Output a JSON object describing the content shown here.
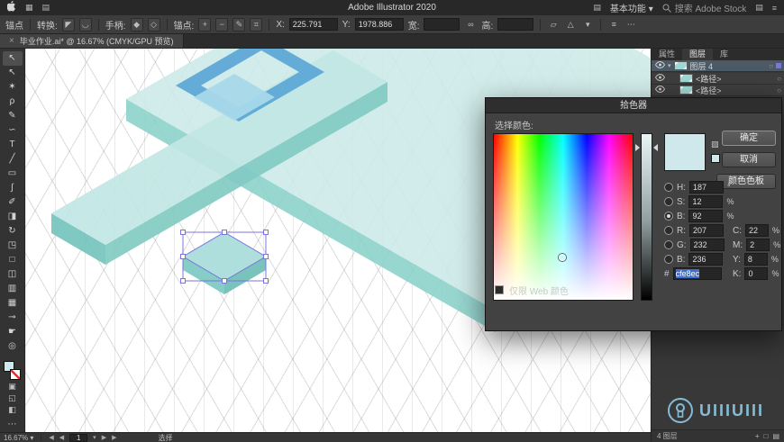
{
  "menubar": {
    "app_title": "Adobe Illustrator 2020",
    "workspace_label": "基本功能",
    "search_placeholder": "搜索 Adobe Stock"
  },
  "controlbar": {
    "anchor_label": "锚点",
    "convert_label": "转换:",
    "handles_label": "手柄:",
    "anchors_label": "锚点:",
    "x_label": "X:",
    "x_value": "225.791",
    "y_label": "Y:",
    "y_value": "1978.886",
    "width_label": "宽:",
    "width_value": "",
    "height_label": "高:",
    "height_value": ""
  },
  "tabbar": {
    "document_title": "毕业作业.ai* @ 16.67% (CMYK/GPU 预览)"
  },
  "toolbar": {
    "fill_color": "#cfe8ec",
    "tools": [
      {
        "name": "selection-tool",
        "glyph": "↖",
        "active": true
      },
      {
        "name": "direct-selection-tool",
        "glyph": "↖"
      },
      {
        "name": "magic-wand-tool",
        "glyph": "✶"
      },
      {
        "name": "lasso-tool",
        "glyph": "ρ"
      },
      {
        "name": "pen-tool",
        "glyph": "✎"
      },
      {
        "name": "curvature-tool",
        "glyph": "∽"
      },
      {
        "name": "type-tool",
        "glyph": "T"
      },
      {
        "name": "line-segment-tool",
        "glyph": "╱"
      },
      {
        "name": "rectangle-tool",
        "glyph": "▭"
      },
      {
        "name": "paintbrush-tool",
        "glyph": "∫"
      },
      {
        "name": "pencil-tool",
        "glyph": "✐"
      },
      {
        "name": "eraser-tool",
        "glyph": "◨"
      },
      {
        "name": "rotate-tool",
        "glyph": "↻"
      },
      {
        "name": "scale-tool",
        "glyph": "◳"
      },
      {
        "name": "free-transform-tool",
        "glyph": "□"
      },
      {
        "name": "shape-builder-tool",
        "glyph": "◫"
      },
      {
        "name": "gradient-tool",
        "glyph": "▥"
      },
      {
        "name": "mesh-tool",
        "glyph": "▦"
      },
      {
        "name": "eyedropper-tool",
        "glyph": "⊸"
      },
      {
        "name": "hand-tool",
        "glyph": "☛"
      },
      {
        "name": "zoom-tool",
        "glyph": "◎"
      }
    ]
  },
  "dialog": {
    "title": "拾色器",
    "select_label": "选择颜色:",
    "ok_label": "确定",
    "cancel_label": "取消",
    "swatches_label": "颜色色板",
    "preview_color": "#cfe8ec",
    "hsb": [
      {
        "label": "H:",
        "value": "187",
        "unit": "°"
      },
      {
        "label": "S:",
        "value": "12",
        "unit": "%"
      },
      {
        "label": "B:",
        "value": "92",
        "unit": "%"
      }
    ],
    "rgb": [
      {
        "label": "R:",
        "value": "207"
      },
      {
        "label": "G:",
        "value": "232"
      },
      {
        "label": "B:",
        "value": "236"
      }
    ],
    "cmyk": [
      {
        "label": "C:",
        "value": "22",
        "unit": "%"
      },
      {
        "label": "M:",
        "value": "2",
        "unit": "%"
      },
      {
        "label": "Y:",
        "value": "8",
        "unit": "%"
      },
      {
        "label": "K:",
        "value": "0",
        "unit": "%"
      }
    ],
    "hex_label": "#",
    "hex_value": "cfe8ec",
    "web_only_label": "仅限 Web 颜色"
  },
  "layers_panel": {
    "tabs": [
      {
        "label": "属性"
      },
      {
        "label": "图层"
      },
      {
        "label": "库"
      }
    ],
    "rows": [
      {
        "name": "图层 4"
      },
      {
        "name": "<路径>"
      },
      {
        "name": "<路径>"
      }
    ],
    "footer_count": "4 图层"
  },
  "statusbar": {
    "zoom": "16.67%",
    "artboard_value": "1",
    "status_text": "选择"
  },
  "watermark": {
    "text": "UIIIUIII"
  },
  "artwork": {
    "selection_color": "#7b74dd",
    "slab_fill": "#cdeae8",
    "slab_edge": "#8dd2cb",
    "plank_fill": "#c2e7e4",
    "plank_edge": "#82cbc3",
    "plank_end": "#76c4bd",
    "blue_frame": "#5ea9d6",
    "blue_diamond": "#a8d8ea",
    "object_top": "#aedfdc",
    "object_side_l": "#85cdc6",
    "object_side_r": "#79c3bc"
  },
  "icons": {
    "caret_down": "▾",
    "target_circle": "○",
    "close": "×",
    "ellipsis": "⋯",
    "menu": "≡",
    "grid_a": "▦",
    "grid_b": "▤",
    "convert_a": "◤",
    "convert_b": "◡",
    "handle_show": "◆",
    "handle_hide": "◇",
    "anchor_add": "+",
    "anchor_remove": "−",
    "pen": "✎",
    "crosshair": "⌖",
    "isolate": "⌗",
    "link": "∞",
    "transform_a": "▱",
    "transform_b": "△",
    "nav_prev": "◀",
    "nav_next": "▶",
    "draw_normal": "▣",
    "draw_behind": "◱",
    "screen_mode": "◧",
    "cube": "▧",
    "footer_new": "+",
    "footer_rect": "□",
    "footer_grid": "▤"
  }
}
